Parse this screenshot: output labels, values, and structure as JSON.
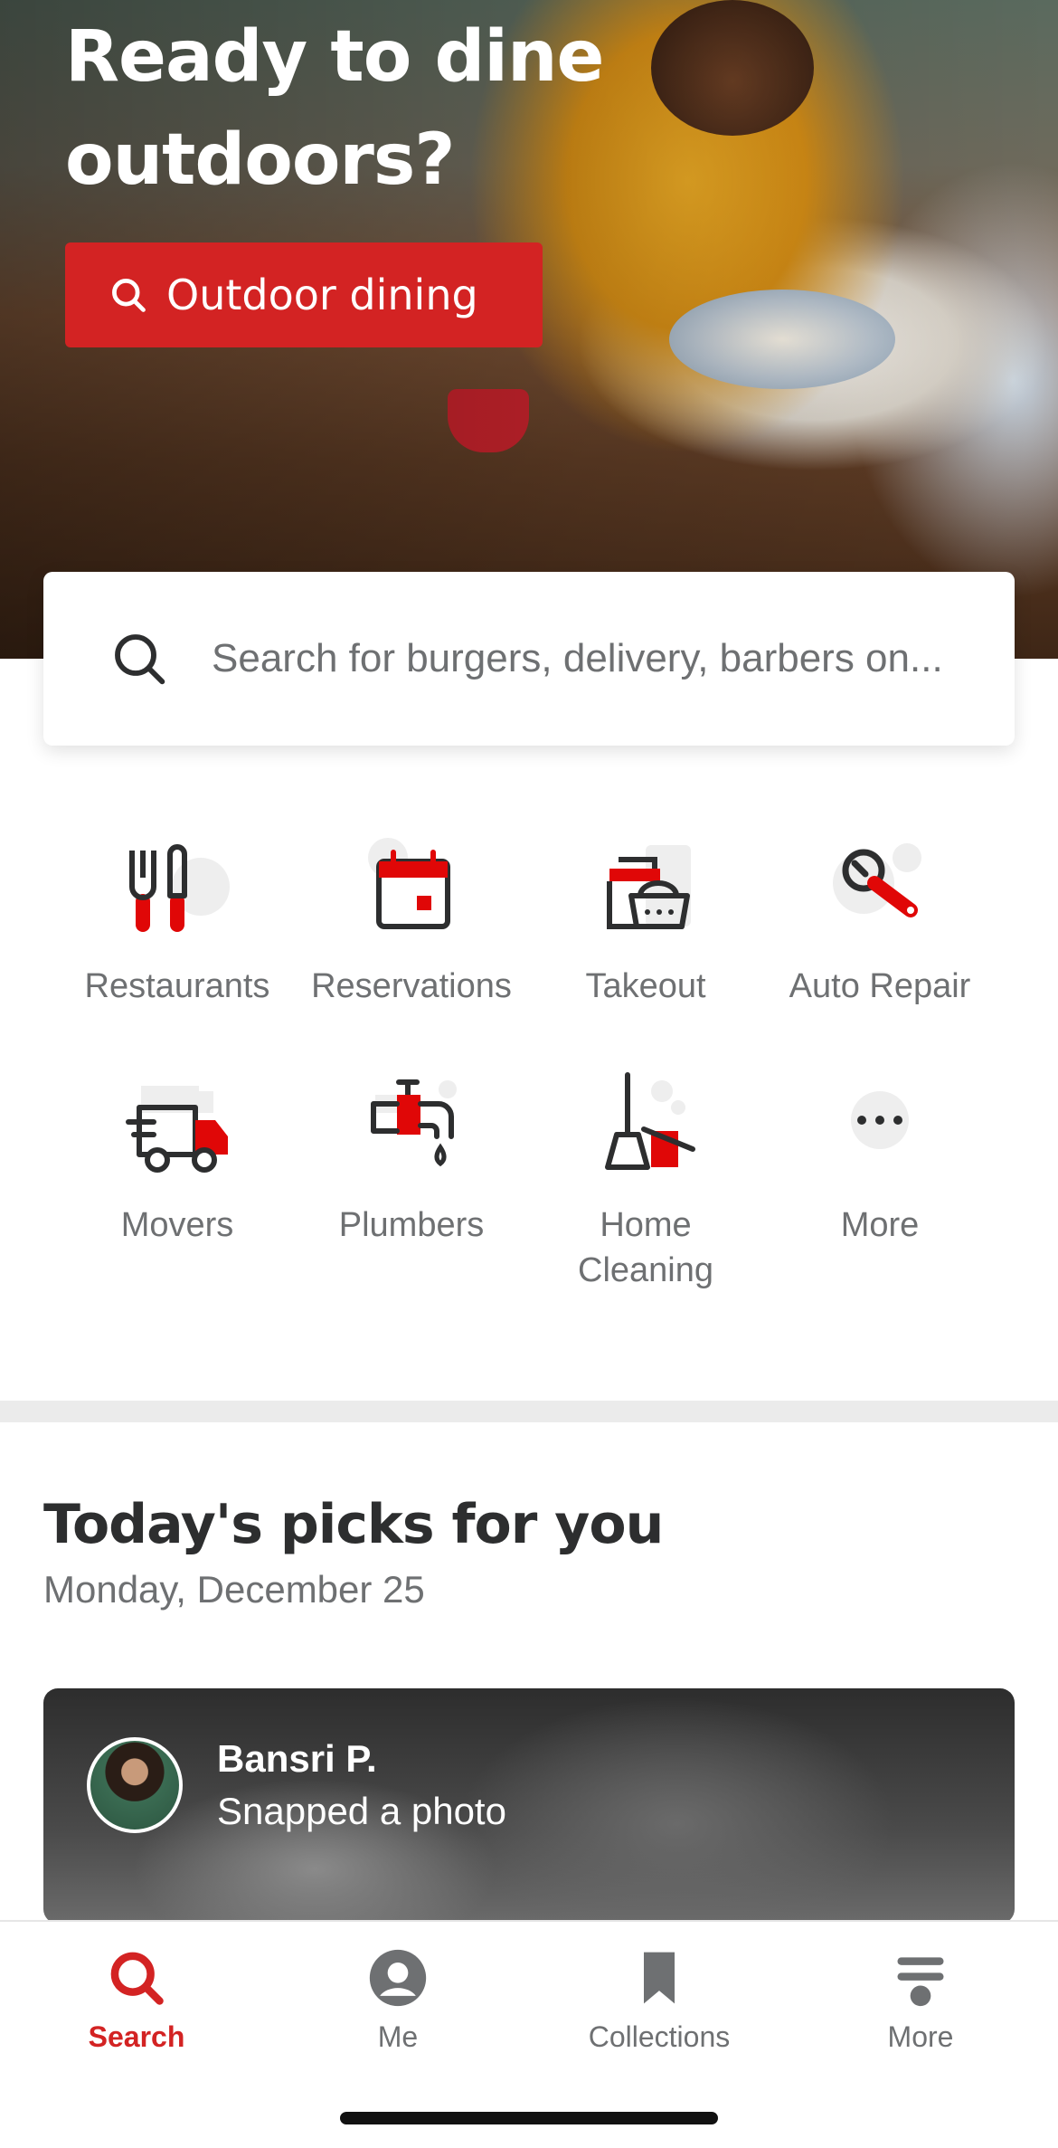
{
  "hero": {
    "title_line1": "Ready to dine",
    "title_line2": "outdoors?",
    "button_label": "Outdoor dining"
  },
  "search": {
    "placeholder": "Search for burgers, delivery, barbers on..."
  },
  "categories": [
    {
      "label": "Restaurants",
      "icon": "fork-knife-icon"
    },
    {
      "label": "Reservations",
      "icon": "calendar-icon"
    },
    {
      "label": "Takeout",
      "icon": "takeout-bag-icon"
    },
    {
      "label": "Auto Repair",
      "icon": "wrench-icon"
    },
    {
      "label": "Movers",
      "icon": "moving-truck-icon"
    },
    {
      "label": "Plumbers",
      "icon": "faucet-icon"
    },
    {
      "label": "Home Cleaning",
      "icon": "broom-icon"
    },
    {
      "label": "More",
      "icon": "more-dots-icon"
    }
  ],
  "picks": {
    "title": "Today's picks for you",
    "date": "Monday, December 25",
    "card": {
      "user_name": "Bansri P.",
      "action": "Snapped a photo"
    }
  },
  "tabbar": {
    "tabs": [
      {
        "label": "Search",
        "icon": "search-icon",
        "active": true
      },
      {
        "label": "Me",
        "icon": "profile-icon",
        "active": false
      },
      {
        "label": "Collections",
        "icon": "bookmark-icon",
        "active": false
      },
      {
        "label": "More",
        "icon": "menu-icon",
        "active": false
      }
    ]
  },
  "colors": {
    "accent": "#d32323",
    "icon_dark": "#2d2e2f",
    "text_muted": "#6e7072"
  }
}
